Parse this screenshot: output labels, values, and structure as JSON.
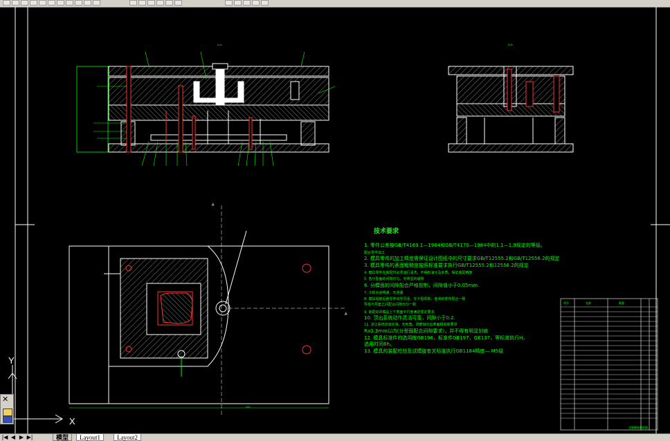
{
  "toolbar": {
    "buttons": [
      "new-icon",
      "open-icon",
      "save-icon",
      "plot-icon",
      "preview-icon",
      "cut-icon",
      "copy-icon",
      "paste-icon",
      "match-properties-icon",
      "undo-icon",
      "redo-icon",
      "pan-icon",
      "zoom-realtime-icon",
      "zoom-window-icon",
      "zoom-previous-icon",
      "properties-icon",
      "design-center-icon",
      "tool-palettes-icon",
      "sheet-set-icon",
      "markup-icon",
      "calculator-icon",
      "help-icon"
    ]
  },
  "drawing": {
    "section_label_main": "A-A",
    "section_label_side": "B-B",
    "top_label": "A",
    "right_label": "A",
    "ucs": {
      "y_label": "Y",
      "x_label": "X"
    },
    "notes_title": "技术要求",
    "notes": [
      "1. 零件公差按GB/T4169.1—1984和GB/T4170—1984中的1.1—1.9规定的等级。",
      "   配合零件加工",
      "2. 模具零件的加工精度需保证设计图纸中的尺寸要求GB/T12555.2和GB/T12556.2的规定",
      "3. 模具零件的表面粗糙度按照标准要求执行GB/T12555.2和12556.2的规定",
      "4. 模具零件在装配时必须进行清洗，不得有油污及杂质，保证装配精度",
      "5. 各分型面的间隙均匀，无明显的缝隙",
      "6. 分模面的间隙配合严格控制，间隙值小于0.05mm.",
      "7. 冷却水道畅通，无泄漏",
      "8. 模具组装后各零件动作灵活，无卡阻现象，各滑动部件配合一致",
      "   导柱与导套之间配合间隙均匀一致",
      "9. 装配好的模具上下表面平行度满足规定要求",
      "10. 顶出系统动作灵活可靠，间隙小于0.2.",
      "11. 浇注系统流道光滑，无死角，研磨抛光后表面粗糙度要求",
      "   Ra0.3mm以内(分型面配合间隙要求)，并不得有明显划痕",
      "12. 模具标准件的选用按GB196，标准件GB197，GB137，等标准执行H，",
      "   选用时间6h。",
      "13. 模具的装配检验及试模按有关标准执行GB1184精度— M5级"
    ],
    "title_block": {
      "header": [
        "序号",
        "名称",
        "数量"
      ],
      "rows": [
        [
          "",
          "",
          ""
        ],
        [
          "",
          "",
          ""
        ],
        [
          "",
          "",
          ""
        ],
        [
          "",
          "",
          ""
        ],
        [
          "",
          "",
          ""
        ],
        [
          "",
          "",
          ""
        ],
        [
          "",
          "",
          ""
        ],
        [
          "",
          "",
          ""
        ],
        [
          "",
          "",
          ""
        ],
        [
          "",
          "",
          ""
        ],
        [
          "",
          "",
          ""
        ],
        [
          "",
          "",
          ""
        ],
        [
          "",
          "",
          ""
        ],
        [
          "",
          "",
          ""
        ],
        [
          "",
          "",
          ""
        ],
        [
          "",
          "",
          ""
        ],
        [
          "",
          "",
          ""
        ],
        [
          "",
          "",
          ""
        ],
        [
          "",
          "",
          ""
        ],
        [
          "",
          "",
          ""
        ],
        [
          "",
          "",
          ""
        ],
        [
          "",
          "",
          ""
        ],
        [
          "",
          "",
          ""
        ],
        [
          "",
          "",
          ""
        ]
      ],
      "footer": "注塑模具装配图"
    },
    "dim_bottom": "450",
    "dim_left": "320"
  },
  "bottom_bar": {
    "nav_buttons": [
      "|◀",
      "◀",
      "▶",
      "▶|"
    ],
    "tabs": [
      "模型",
      "Layout1",
      "Layout2"
    ],
    "active_tab": "模型"
  },
  "colors": {
    "background": "#000000",
    "outline": "#ffffff",
    "hatch": "#ffffff",
    "green": "#00ff00",
    "red": "#ff3030",
    "cyan_text": "#00ff00"
  }
}
